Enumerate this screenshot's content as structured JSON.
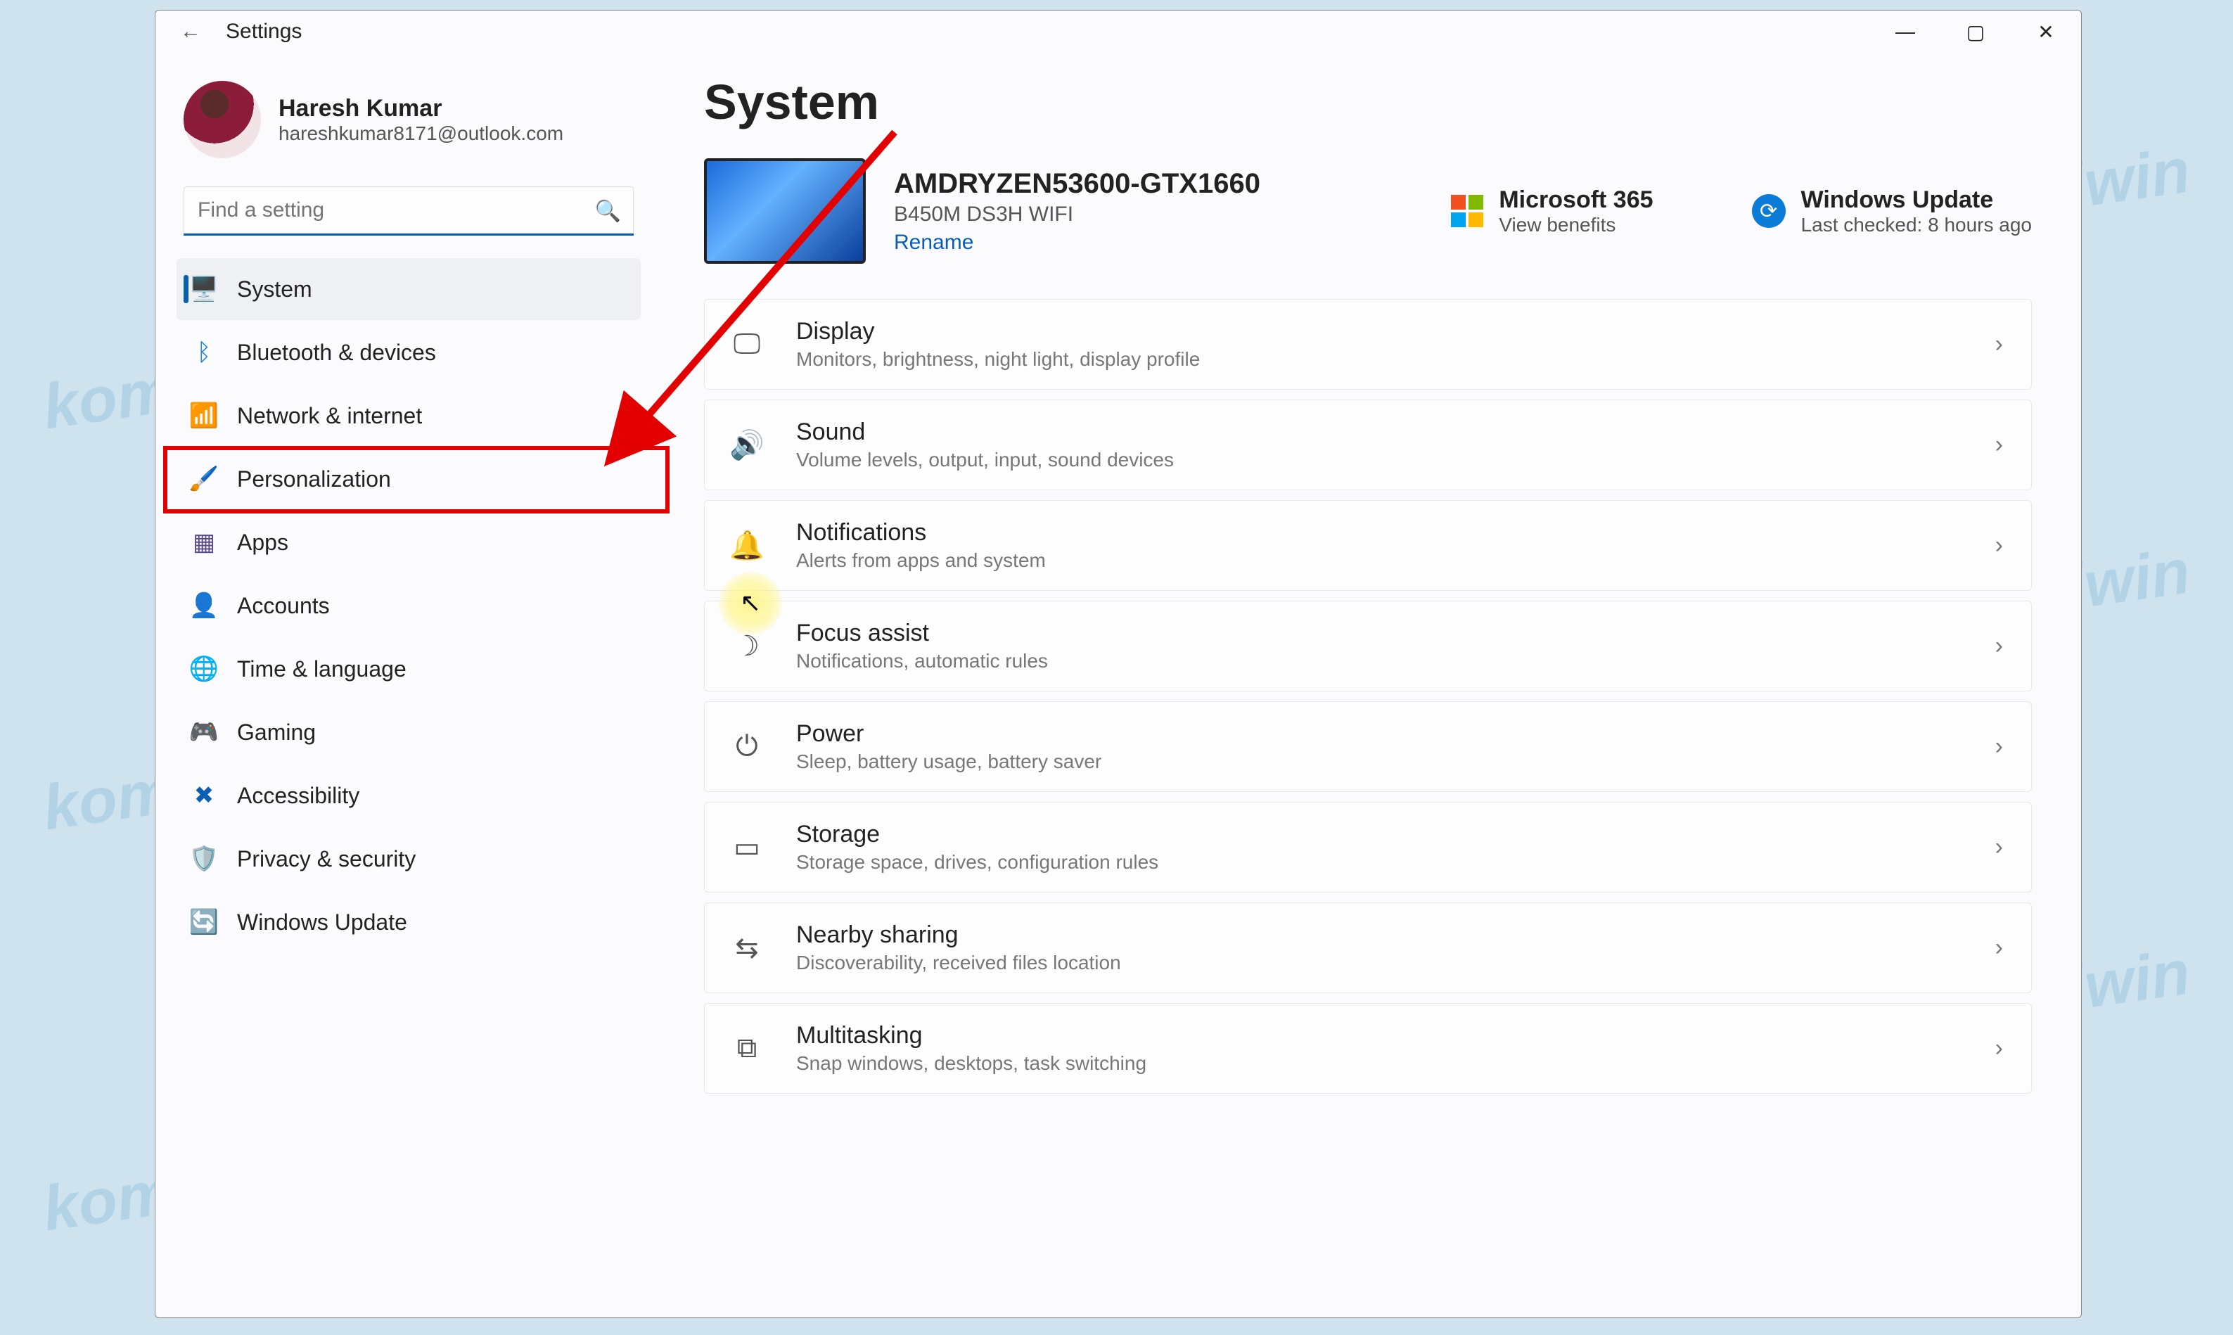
{
  "watermark_text": "kompiwin",
  "window": {
    "title": "Settings",
    "controls": {
      "min": "—",
      "max": "▢",
      "close": "✕"
    }
  },
  "profile": {
    "name": "Haresh Kumar",
    "email": "hareshkumar8171@outlook.com"
  },
  "search": {
    "placeholder": "Find a setting"
  },
  "nav": [
    {
      "icon": "🖥️",
      "label": "System",
      "active": true,
      "color": "#0a5fb5"
    },
    {
      "icon": "ᛒ",
      "label": "Bluetooth & devices",
      "color": "#0a7cd8"
    },
    {
      "icon": "📶",
      "label": "Network & internet",
      "color": "#0a7cd8"
    },
    {
      "icon": "🖌️",
      "label": "Personalization",
      "color": "#b86b12"
    },
    {
      "icon": "▦",
      "label": "Apps",
      "color": "#5a4b8c"
    },
    {
      "icon": "👤",
      "label": "Accounts",
      "color": "#2b9b62"
    },
    {
      "icon": "🌐",
      "label": "Time & language",
      "color": "#1b9bb3"
    },
    {
      "icon": "🎮",
      "label": "Gaming",
      "color": "#888"
    },
    {
      "icon": "✖",
      "label": "Accessibility",
      "color": "#0a5fb5"
    },
    {
      "icon": "🛡️",
      "label": "Privacy & security",
      "color": "#888"
    },
    {
      "icon": "🔄",
      "label": "Windows Update",
      "color": "#0a7cd8"
    }
  ],
  "page": {
    "title": "System"
  },
  "device": {
    "name": "AMDRYZEN53600-GTX1660",
    "motherboard": "B450M DS3H WIFI",
    "rename": "Rename"
  },
  "cards": {
    "m365": {
      "title": "Microsoft 365",
      "sub": "View benefits"
    },
    "wu": {
      "title": "Windows Update",
      "sub": "Last checked: 8 hours ago"
    }
  },
  "settings": [
    {
      "icon": "🖵",
      "title": "Display",
      "desc": "Monitors, brightness, night light, display profile"
    },
    {
      "icon": "🔊",
      "title": "Sound",
      "desc": "Volume levels, output, input, sound devices"
    },
    {
      "icon": "🔔",
      "title": "Notifications",
      "desc": "Alerts from apps and system"
    },
    {
      "icon": "☽",
      "title": "Focus assist",
      "desc": "Notifications, automatic rules"
    },
    {
      "icon": "⏻",
      "title": "Power",
      "desc": "Sleep, battery usage, battery saver"
    },
    {
      "icon": "▭",
      "title": "Storage",
      "desc": "Storage space, drives, configuration rules"
    },
    {
      "icon": "⇆",
      "title": "Nearby sharing",
      "desc": "Discoverability, received files location"
    },
    {
      "icon": "⧉",
      "title": "Multitasking",
      "desc": "Snap windows, desktops, task switching"
    }
  ],
  "highlight_nav_index": 3
}
